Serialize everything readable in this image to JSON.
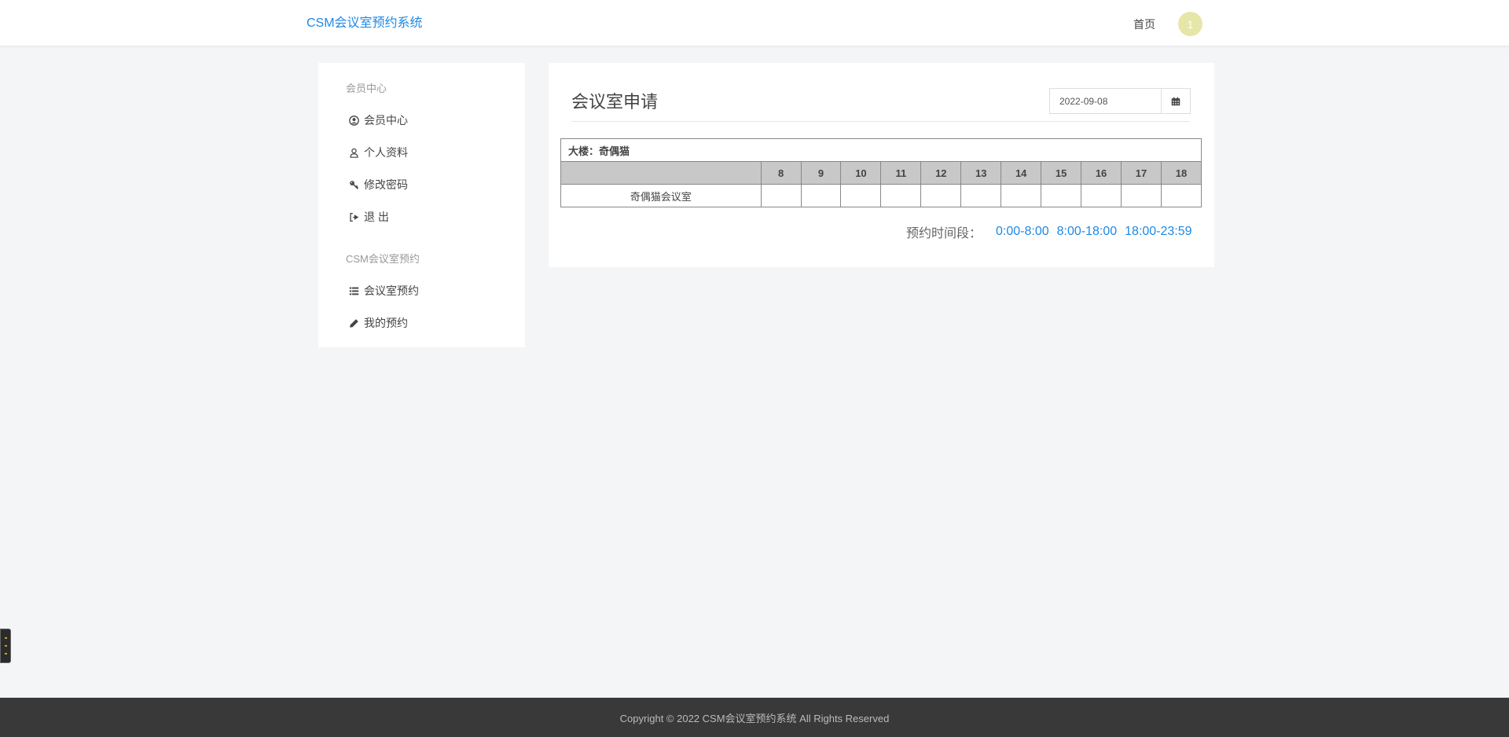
{
  "header": {
    "brand": "CSM会议室预约系统",
    "nav_home": "首页",
    "avatar_text": "1"
  },
  "sidebar": {
    "section1": "会员中心",
    "items1": [
      {
        "label": "会员中心",
        "icon": "user-circle-icon"
      },
      {
        "label": "个人资料",
        "icon": "user-icon"
      },
      {
        "label": "修改密码",
        "icon": "key-icon"
      },
      {
        "label": "退 出",
        "icon": "sign-out-icon"
      }
    ],
    "section2": "CSM会议室预约",
    "items2": [
      {
        "label": "会议室预约",
        "icon": "list-icon"
      },
      {
        "label": "我的预约",
        "icon": "pencil-icon"
      }
    ]
  },
  "main": {
    "title": "会议室申请",
    "date_value": "2022-09-08",
    "calendar_icon": "calendar-icon",
    "building_label": "大楼：奇偶猫",
    "hours": [
      "8",
      "9",
      "10",
      "11",
      "12",
      "13",
      "14",
      "15",
      "16",
      "17",
      "18"
    ],
    "room_name": "奇偶猫会议室",
    "legend_label": "预约时间段：",
    "legend_items": [
      "0:00-8:00",
      "8:00-18:00",
      "18:00-23:59"
    ]
  },
  "footer": {
    "copyright": "Copyright © 2022 CSM会议室预约系统 All Rights Reserved"
  },
  "colors": {
    "accent": "#1e88e5",
    "background": "#f4f5f7",
    "footer_bg": "#393939",
    "table_header_bg": "#c8c8c8",
    "avatar_bg": "#e6e6a8"
  }
}
